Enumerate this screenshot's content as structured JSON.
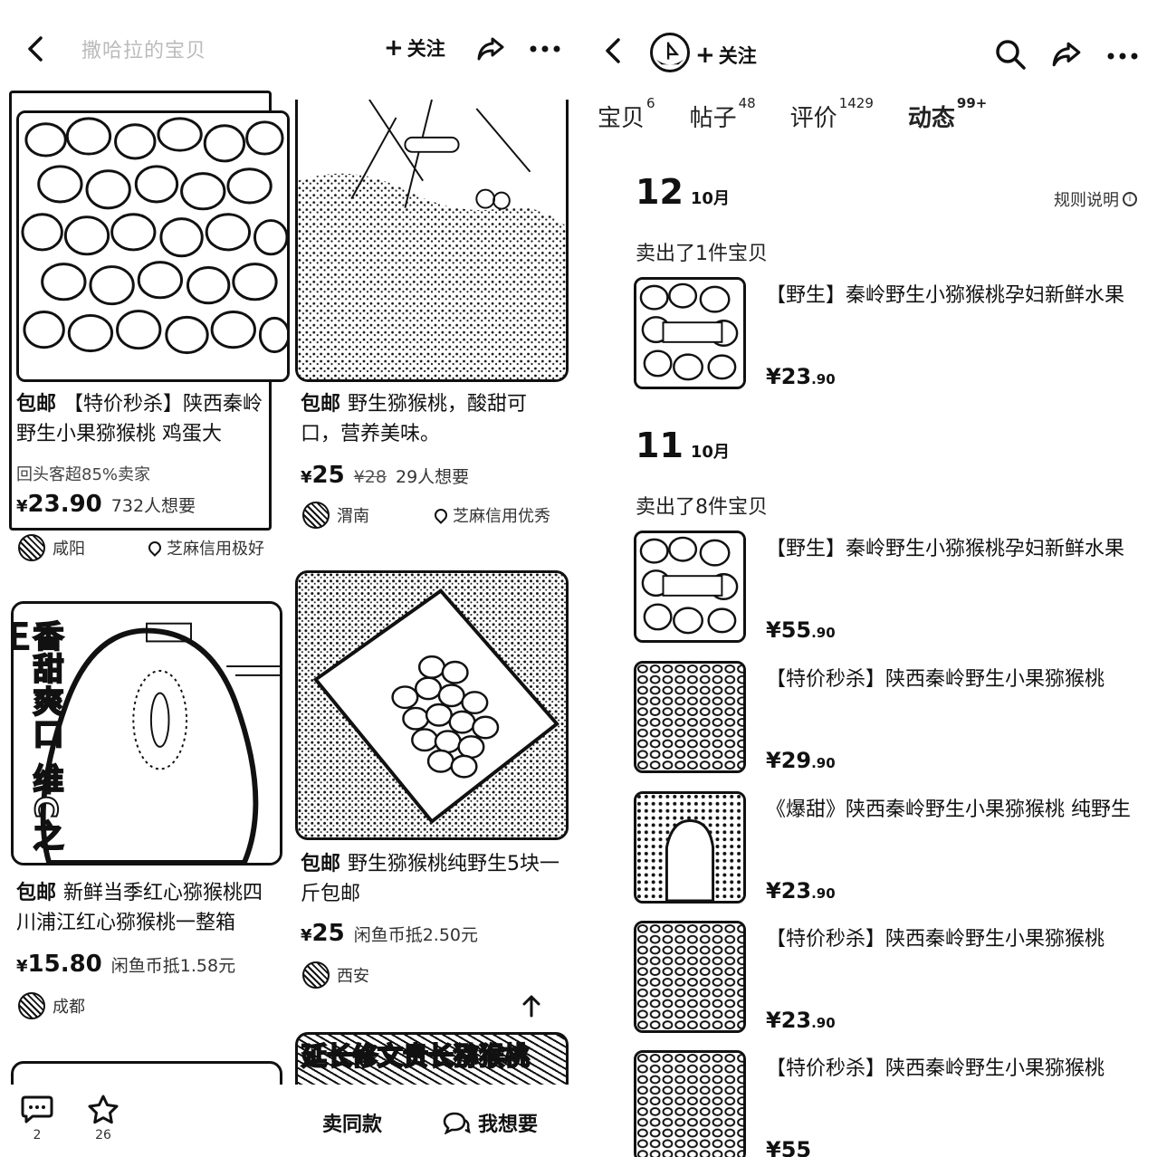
{
  "left": {
    "header": {
      "shop_title": "撒哈拉的宝贝",
      "follow_label": "关注"
    },
    "cards": [
      {
        "tag": "包邮",
        "title": "【特价秒杀】陕西秦岭野生小果猕猴桃 鸡蛋大",
        "note": "回头客超85%卖家",
        "price": "23.90",
        "extra": "732人想要",
        "location": "咸阳",
        "credit": "芝麻信用极好"
      },
      {
        "tag": "包邮",
        "title": "野生猕猴桃，酸甜可口，营养美味。",
        "price": "25",
        "old_price": "¥28",
        "extra": "29人想要",
        "location": "渭南",
        "credit": "芝麻信用优秀"
      },
      {
        "overlay": "香甜爽口 维C之王",
        "tag": "包邮",
        "title": "新鲜当季红心猕猴桃四川浦江红心猕猴桃一整箱",
        "price": "15.80",
        "extra": "闲鱼币抵1.58元",
        "location": "成都"
      },
      {
        "tag": "包邮",
        "title": "野生猕猴桃纯野生5块一斤包邮",
        "price": "25",
        "extra": "闲鱼币抵2.50元",
        "location": "西安"
      },
      {
        "banner": "延长修文贵长猕猴桃"
      }
    ],
    "bottom": {
      "comment_count": "2",
      "fav_count": "26",
      "sell_same": "卖同款",
      "want": "我想要"
    }
  },
  "right": {
    "header": {
      "follow_label": "关注"
    },
    "tabs": [
      {
        "label": "宝贝",
        "count": "6"
      },
      {
        "label": "帖子",
        "count": "48"
      },
      {
        "label": "评价",
        "count": "1429"
      },
      {
        "label": "动态",
        "count": "99+"
      }
    ],
    "rules_label": "规则说明",
    "groups": [
      {
        "day": "12",
        "month": "10月",
        "sold": "卖出了1件宝贝",
        "items": [
          {
            "title": "【野生】秦岭野生小猕猴桃孕妇新鲜水果",
            "price_int": "¥23",
            "price_dec": ".90"
          }
        ]
      },
      {
        "day": "11",
        "month": "10月",
        "sold": "卖出了8件宝贝",
        "items": [
          {
            "title": "【野生】秦岭野生小猕猴桃孕妇新鲜水果",
            "price_int": "¥55",
            "price_dec": ".90"
          },
          {
            "title": "【特价秒杀】陕西秦岭野生小果猕猴桃",
            "price_int": "¥29",
            "price_dec": ".90"
          },
          {
            "title": "《爆甜》陕西秦岭野生小果猕猴桃 纯野生",
            "price_int": "¥23",
            "price_dec": ".90"
          },
          {
            "title": "【特价秒杀】陕西秦岭野生小果猕猴桃",
            "price_int": "¥23",
            "price_dec": ".90"
          },
          {
            "title": "【特价秒杀】陕西秦岭野生小果猕猴桃",
            "price_int": "¥55",
            "price_dec": ""
          }
        ]
      }
    ]
  }
}
